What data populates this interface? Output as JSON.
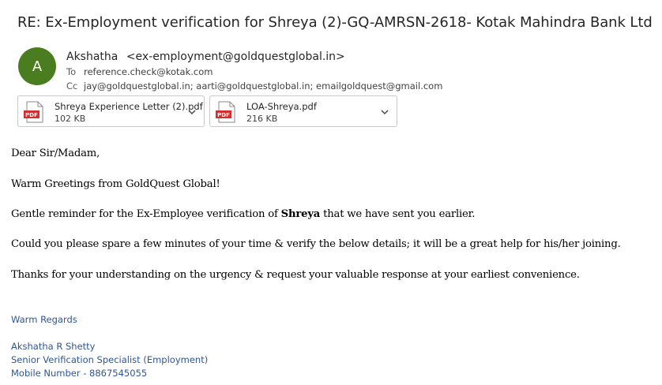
{
  "email": {
    "subject": "RE: Ex-Employment verification for Shreya (2)-GQ-AMRSN-2618- Kotak Mahindra Bank Ltd",
    "sender": {
      "avatar_initial": "A",
      "avatar_color": "#4a7d1f",
      "name": "Akshatha",
      "email": "<ex-employment@goldquestglobal.in>"
    },
    "to": {
      "label": "To",
      "value": "reference.check@kotak.com"
    },
    "cc": {
      "label": "Cc",
      "value": "jay@goldquestglobal.in; aarti@goldquestglobal.in; emailgoldquest@gmail.com"
    },
    "attachments": [
      {
        "name": "Shreya Experience Letter (2).pdf",
        "size": "102 KB",
        "icon": "pdf-icon"
      },
      {
        "name": "LOA-Shreya.pdf",
        "size": "216 KB",
        "icon": "pdf-icon"
      }
    ],
    "body": {
      "greeting": "Dear Sir/Madam,",
      "line1": "Warm Greetings from GoldQuest Global!",
      "line2_pre": "Gentle reminder for the Ex-Employee verification of ",
      "line2_bold": "Shreya",
      "line2_post": " that we have sent you earlier.",
      "line3": "Could you please spare a few minutes of your time & verify the below details; it will be a great help for his/her joining.",
      "line4": "Thanks for your understanding on the urgency & request your valuable response at your earliest convenience."
    },
    "signature": {
      "closing": "Warm Regards",
      "name": "Akshatha R Shetty",
      "title": "Senior Verification Specialist (Employment)",
      "mobile": "Mobile Number - 8867545055",
      "color": "#2e5597"
    }
  }
}
